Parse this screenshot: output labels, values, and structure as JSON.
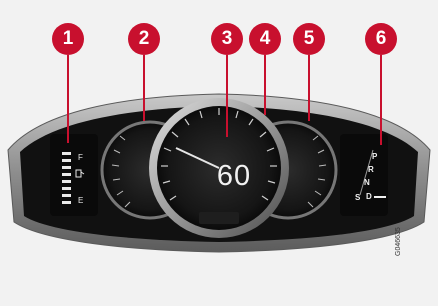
{
  "callouts": [
    "1",
    "2",
    "3",
    "4",
    "5",
    "6"
  ],
  "fuel_gauge": {
    "full_label": "F",
    "empty_label": "E"
  },
  "speedometer": {
    "speed": "60"
  },
  "gear_indicator": {
    "gears": [
      "P",
      "R",
      "N",
      "D"
    ],
    "sport_label": "S"
  },
  "figure_code": "G046635",
  "colors": {
    "callout": "#c8102e",
    "bezel": "#8a8a8a",
    "display": "#111111"
  }
}
